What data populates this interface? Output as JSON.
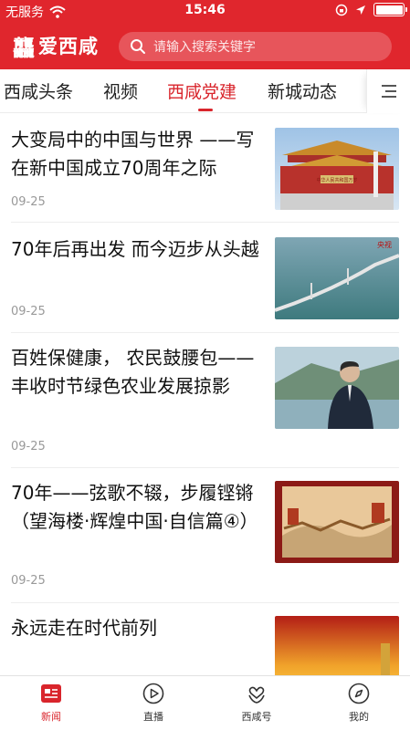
{
  "status_bar": {
    "carrier": "无服务",
    "time": "15:46"
  },
  "header": {
    "logo_text": "龘",
    "app_name": "爱西咸",
    "search_placeholder": "请输入搜索关键字"
  },
  "tabs": [
    {
      "label": "西咸头条",
      "active": false
    },
    {
      "label": "视频",
      "active": false
    },
    {
      "label": "西咸党建",
      "active": true
    },
    {
      "label": "新城动态",
      "active": false
    }
  ],
  "articles": [
    {
      "title": "大变局中的中国与世界 ——写在新中国成立70周年之际",
      "date": "09-25",
      "thumb_badge": "中华人民共和国万岁"
    },
    {
      "title": "70年后再出发 而今迈步从头越",
      "date": "09-25",
      "thumb_badge": "央视"
    },
    {
      "title": "百姓保健康， 农民鼓腰包——丰收时节绿色农业发展掠影",
      "date": "09-25"
    },
    {
      "title": "70年——弦歌不辍，步履铿锵（望海楼·辉煌中国·自信篇④）",
      "date": "09-25"
    },
    {
      "title": "永远走在时代前列",
      "date": ""
    }
  ],
  "bottom_nav": [
    {
      "label": "新闻",
      "icon": "news-icon",
      "active": true
    },
    {
      "label": "直播",
      "icon": "play-circle-icon",
      "active": false
    },
    {
      "label": "西咸号",
      "icon": "heart-hands-icon",
      "active": false
    },
    {
      "label": "我的",
      "icon": "compass-icon",
      "active": false
    }
  ],
  "colors": {
    "brand_red": "#e0262d",
    "active_red": "#d9252c",
    "date_gray": "#999999"
  }
}
